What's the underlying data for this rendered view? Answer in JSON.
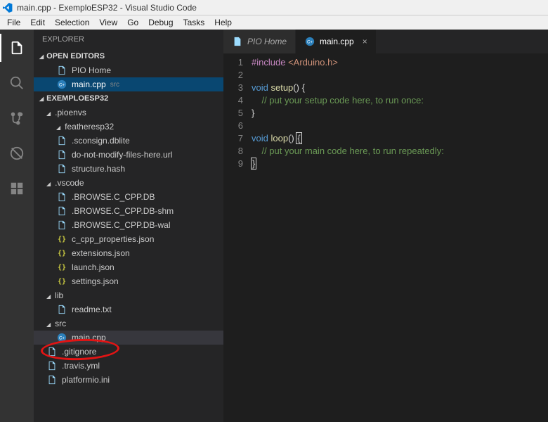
{
  "window_title": "main.cpp - ExemploESP32 - Visual Studio Code",
  "menu": [
    "File",
    "Edit",
    "Selection",
    "View",
    "Go",
    "Debug",
    "Tasks",
    "Help"
  ],
  "sidebar": {
    "panel": "EXPLORER",
    "open_editors": "OPEN EDITORS",
    "project": "EXEMPLOESP32",
    "editors": [
      {
        "label": "PIO Home",
        "icon": "text-file"
      },
      {
        "label": "main.cpp",
        "suffix": "src",
        "icon": "cpp",
        "current": true
      }
    ],
    "tree": [
      {
        "l": 1,
        "type": "folder",
        "label": ".pioenvs"
      },
      {
        "l": 2,
        "type": "folder",
        "label": "featheresp32"
      },
      {
        "l": 2,
        "type": "file",
        "label": ".sconsign.dblite"
      },
      {
        "l": 2,
        "type": "file",
        "label": "do-not-modify-files-here.url"
      },
      {
        "l": 2,
        "type": "file",
        "label": "structure.hash"
      },
      {
        "l": 1,
        "type": "folder",
        "label": ".vscode"
      },
      {
        "l": 2,
        "type": "file",
        "label": ".BROWSE.C_CPP.DB"
      },
      {
        "l": 2,
        "type": "file",
        "label": ".BROWSE.C_CPP.DB-shm"
      },
      {
        "l": 2,
        "type": "file",
        "label": ".BROWSE.C_CPP.DB-wal"
      },
      {
        "l": 2,
        "type": "json",
        "label": "c_cpp_properties.json"
      },
      {
        "l": 2,
        "type": "json",
        "label": "extensions.json"
      },
      {
        "l": 2,
        "type": "json",
        "label": "launch.json"
      },
      {
        "l": 2,
        "type": "json",
        "label": "settings.json"
      },
      {
        "l": 1,
        "type": "folder",
        "label": "lib"
      },
      {
        "l": 2,
        "type": "file",
        "label": "readme.txt"
      },
      {
        "l": 1,
        "type": "folder",
        "label": "src"
      },
      {
        "l": 2,
        "type": "cpp",
        "label": "main.cpp",
        "sel": true
      },
      {
        "l": 1,
        "type": "file",
        "label": ".gitignore"
      },
      {
        "l": 1,
        "type": "file",
        "label": ".travis.yml"
      },
      {
        "l": 1,
        "type": "file",
        "label": "platformio.ini"
      }
    ]
  },
  "tabs": [
    {
      "label": "PIO Home",
      "icon": "text"
    },
    {
      "label": "main.cpp",
      "icon": "cpp",
      "active": true
    }
  ],
  "code": [
    {
      "n": 1,
      "html": "<span class='t-mac'>#include</span> <span class='t-inc'>&lt;Arduino.h&gt;</span>"
    },
    {
      "n": 2,
      "html": ""
    },
    {
      "n": 3,
      "html": "<span class='t-kw'>void</span> <span class='t-fun'>setup</span>() {"
    },
    {
      "n": 4,
      "html": "    <span class='t-com'>// put your setup code here, to run once:</span>"
    },
    {
      "n": 5,
      "html": "}"
    },
    {
      "n": 6,
      "html": ""
    },
    {
      "n": 7,
      "html": "<span class='t-kw'>void</span> <span class='t-fun'>loop</span>() <span class='cursor-box'>{</span>"
    },
    {
      "n": 8,
      "html": "    <span class='t-com'>// put your main code here, to run repeatedly:</span>"
    },
    {
      "n": 9,
      "html": "<span class='cursor-box'>}</span>"
    }
  ]
}
